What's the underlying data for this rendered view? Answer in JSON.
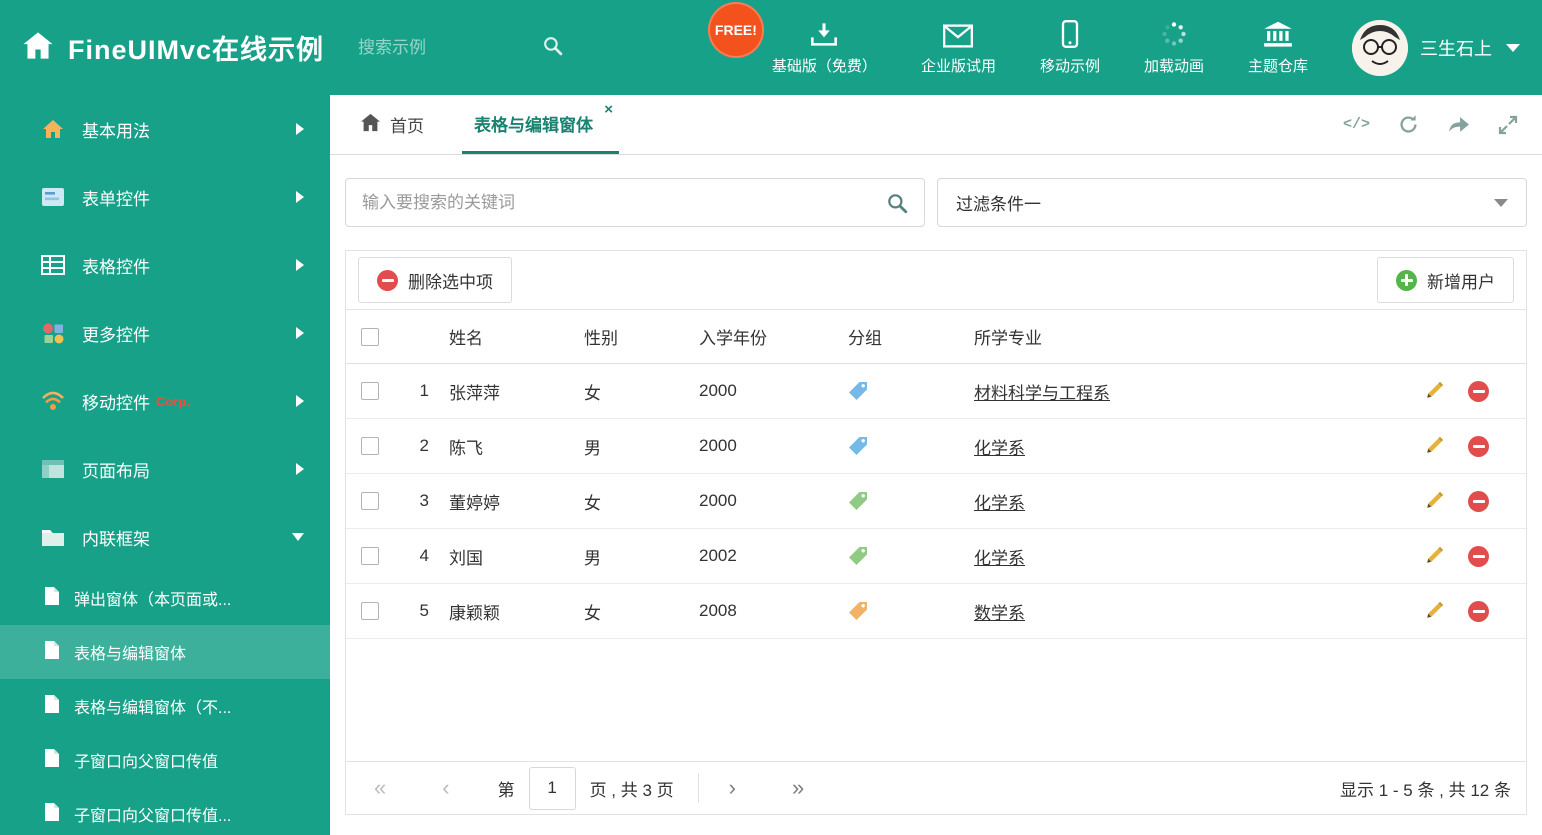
{
  "colors": {
    "theme_teal": "#18a189",
    "tab_active_teal": "#1a8271",
    "free_badge_orange": "#f4521d",
    "delete_red": "#e14c4c",
    "add_green": "#55b54a",
    "pencil_orange": "#e8b23a",
    "tag_blue": "#74b9e8",
    "tag_green": "#8fcb84",
    "tag_orange": "#f2b267"
  },
  "header": {
    "title": "FineUIMvc在线示例",
    "search_placeholder": "搜索示例",
    "free_badge": "FREE!",
    "nav_items": [
      {
        "label": "基础版（免费）"
      },
      {
        "label": "企业版试用"
      },
      {
        "label": "移动示例"
      },
      {
        "label": "加载动画"
      },
      {
        "label": "主题仓库"
      }
    ],
    "user_name": "三生石上"
  },
  "sidebar": {
    "items": [
      {
        "label": "基本用法"
      },
      {
        "label": "表单控件"
      },
      {
        "label": "表格控件"
      },
      {
        "label": "更多控件"
      },
      {
        "label": "移动控件",
        "badge": "Corp."
      },
      {
        "label": "页面布局"
      },
      {
        "label": "内联框架"
      }
    ],
    "subitems": [
      {
        "label": "弹出窗体（本页面或..."
      },
      {
        "label": "表格与编辑窗体"
      },
      {
        "label": "表格与编辑窗体（不..."
      },
      {
        "label": "子窗口向父窗口传值"
      },
      {
        "label": "子窗口向父窗口传值..."
      }
    ]
  },
  "tabs": {
    "home": "首页",
    "active": "表格与编辑窗体",
    "close": "×"
  },
  "filters": {
    "search_placeholder": "输入要搜索的关键词",
    "selected_filter": "过滤条件一"
  },
  "toolbar": {
    "delete_selected": "删除选中项",
    "add_user": "新增用户"
  },
  "table": {
    "headers": {
      "name": "姓名",
      "gender": "性别",
      "year": "入学年份",
      "group": "分组",
      "major": "所学专业"
    },
    "rows": [
      {
        "num": "1",
        "name": "张萍萍",
        "gender": "女",
        "year": "2000",
        "tag_color": "#74b9e8",
        "major": "材料科学与工程系"
      },
      {
        "num": "2",
        "name": "陈飞",
        "gender": "男",
        "year": "2000",
        "tag_color": "#74b9e8",
        "major": "化学系"
      },
      {
        "num": "3",
        "name": "董婷婷",
        "gender": "女",
        "year": "2000",
        "tag_color": "#8fcb84",
        "major": "化学系"
      },
      {
        "num": "4",
        "name": "刘国",
        "gender": "男",
        "year": "2002",
        "tag_color": "#8fcb84",
        "major": "化学系"
      },
      {
        "num": "5",
        "name": "康颖颖",
        "gender": "女",
        "year": "2008",
        "tag_color": "#f2b267",
        "major": "数学系"
      }
    ]
  },
  "pagination": {
    "first": "«",
    "prev": "‹",
    "next": "›",
    "last": "»",
    "label_before": "第",
    "current_page": "1",
    "label_after": "页 , 共 3 页",
    "summary": "显示 1 - 5 条 , 共 12 条"
  }
}
